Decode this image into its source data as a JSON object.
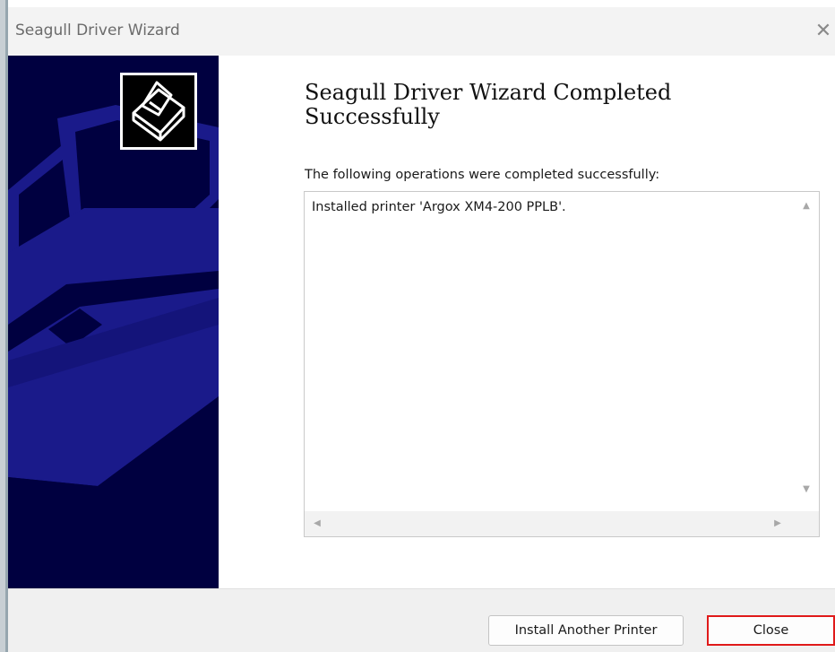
{
  "window": {
    "title": "Seagull Driver Wizard",
    "close_glyph": "✕"
  },
  "content": {
    "heading": "Seagull Driver Wizard Completed Successfully",
    "subtext": "The following operations were completed successfully:",
    "operations": [
      "Installed printer 'Argox XM4-200 PPLB'."
    ]
  },
  "buttons": {
    "install_another": "Install Another Printer",
    "close": "Close"
  },
  "icons": [
    "printer-icon",
    "close-icon",
    "scroll-up-icon",
    "scroll-down-icon",
    "scroll-left-icon",
    "scroll-right-icon"
  ],
  "colors": {
    "banner": "#000040",
    "banner_art": "#1a1a8a",
    "close_highlight": "#e01a1a"
  }
}
